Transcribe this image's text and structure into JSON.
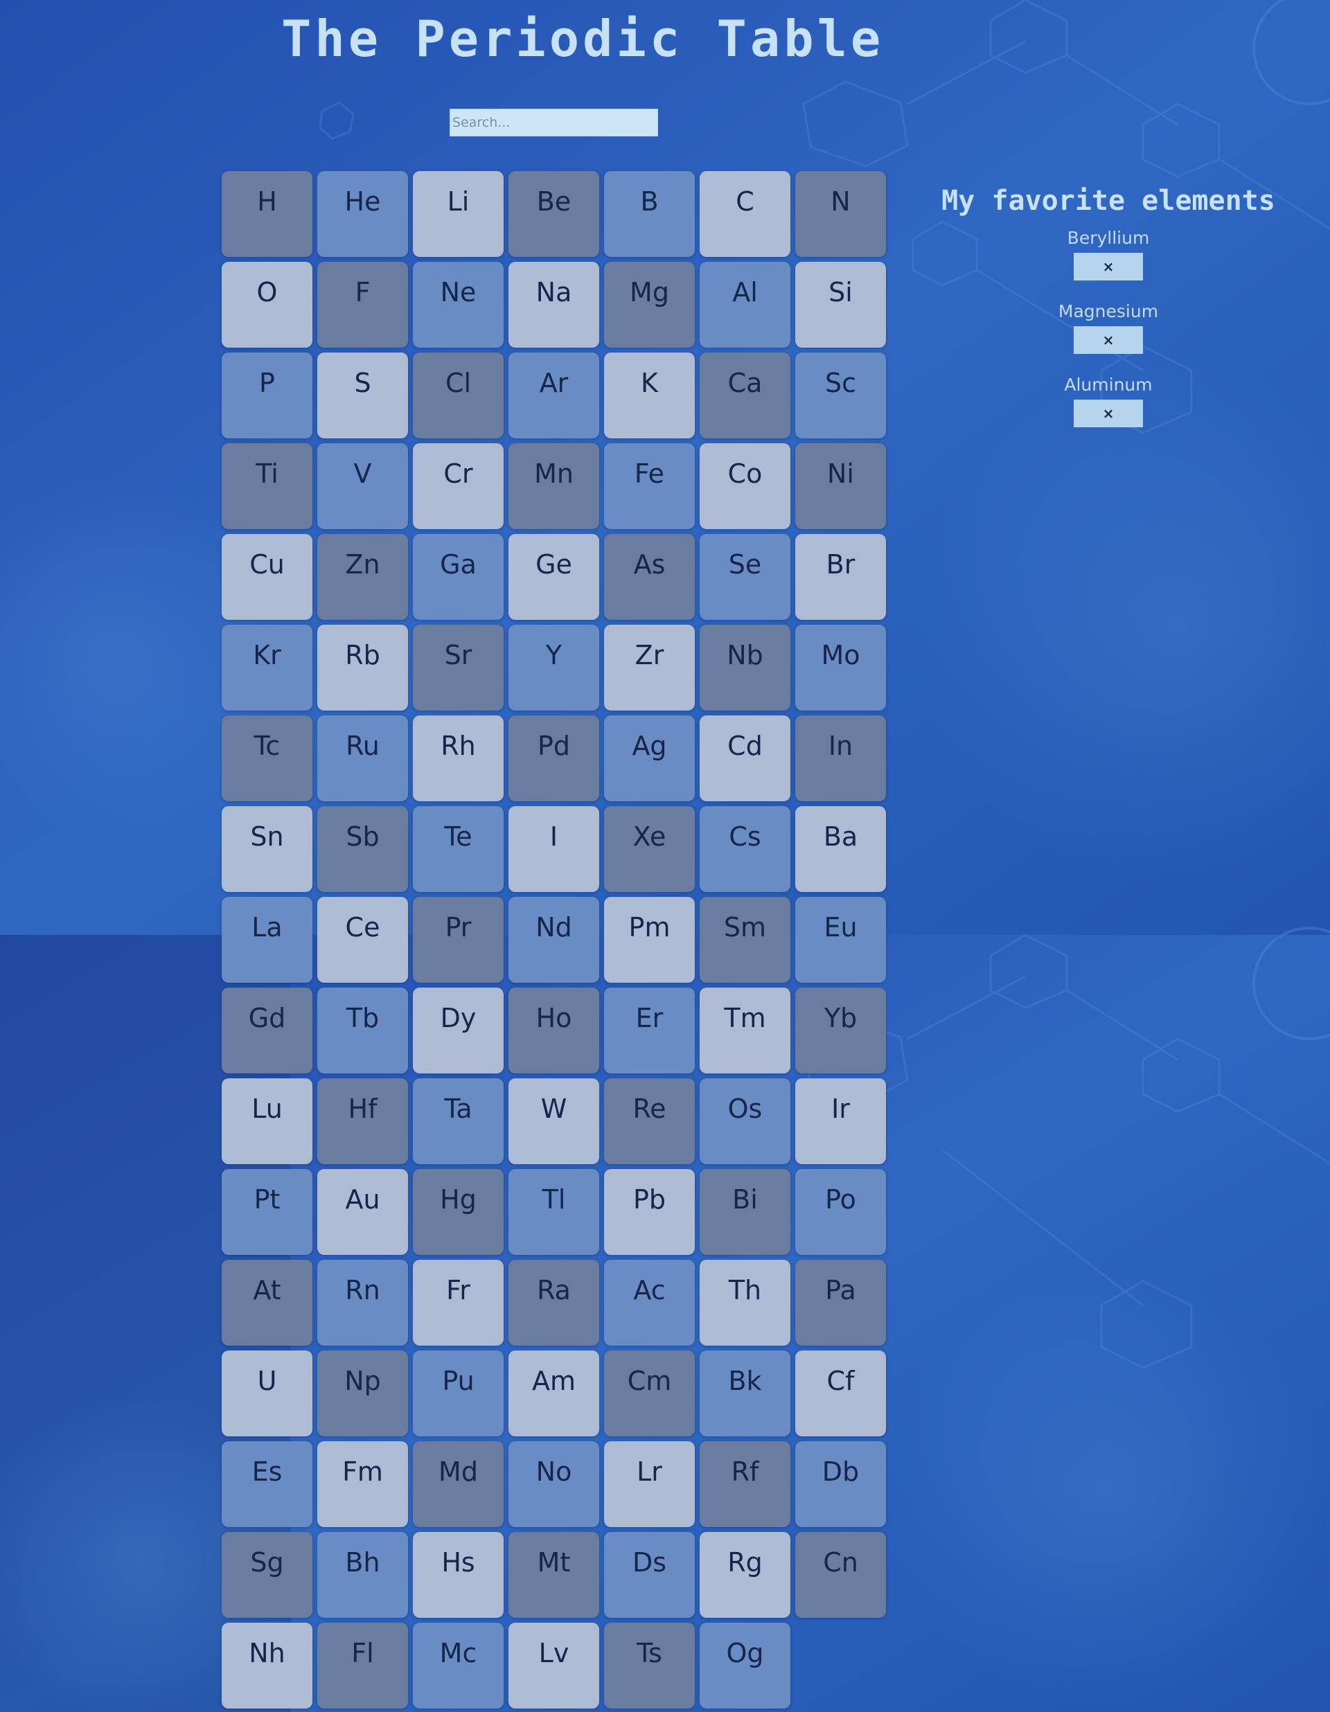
{
  "header": {
    "title": "The Periodic Table"
  },
  "search": {
    "placeholder": "Search...",
    "value": ""
  },
  "elements": [
    "H",
    "He",
    "Li",
    "Be",
    "B",
    "C",
    "N",
    "O",
    "F",
    "Ne",
    "Na",
    "Mg",
    "Al",
    "Si",
    "P",
    "S",
    "Cl",
    "Ar",
    "K",
    "Ca",
    "Sc",
    "Ti",
    "V",
    "Cr",
    "Mn",
    "Fe",
    "Co",
    "Ni",
    "Cu",
    "Zn",
    "Ga",
    "Ge",
    "As",
    "Se",
    "Br",
    "Kr",
    "Rb",
    "Sr",
    "Y",
    "Zr",
    "Nb",
    "Mo",
    "Tc",
    "Ru",
    "Rh",
    "Pd",
    "Ag",
    "Cd",
    "In",
    "Sn",
    "Sb",
    "Te",
    "I",
    "Xe",
    "Cs",
    "Ba",
    "La",
    "Ce",
    "Pr",
    "Nd",
    "Pm",
    "Sm",
    "Eu",
    "Gd",
    "Tb",
    "Dy",
    "Ho",
    "Er",
    "Tm",
    "Yb",
    "Lu",
    "Hf",
    "Ta",
    "W",
    "Re",
    "Os",
    "Ir",
    "Pt",
    "Au",
    "Hg",
    "Tl",
    "Pb",
    "Bi",
    "Po",
    "At",
    "Rn",
    "Fr",
    "Ra",
    "Ac",
    "Th",
    "Pa",
    "U",
    "Np",
    "Pu",
    "Am",
    "Cm",
    "Bk",
    "Cf",
    "Es",
    "Fm",
    "Md",
    "No",
    "Lr",
    "Rf",
    "Db",
    "Sg",
    "Bh",
    "Hs",
    "Mt",
    "Ds",
    "Rg",
    "Cn",
    "Nh",
    "Fl",
    "Mc",
    "Lv",
    "Ts",
    "Og"
  ],
  "favorites": {
    "title": "My favorite elements",
    "remove_label": "×",
    "items": [
      {
        "name": "Beryllium"
      },
      {
        "name": "Magnesium"
      },
      {
        "name": "Aluminum"
      }
    ]
  },
  "colors": {
    "tile_dark": "#6a7ca0",
    "tile_mid": "#6a8cc4",
    "tile_light": "#aebbd4",
    "title_text": "#c7e2f7",
    "background": "#2c62bc"
  }
}
